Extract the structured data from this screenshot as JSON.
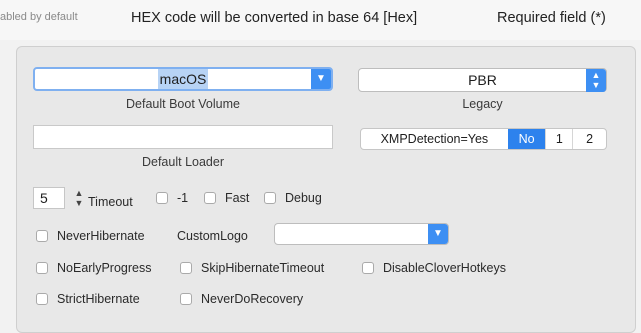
{
  "header": {
    "dim_text": "abled by default",
    "hex_note": "HEX code will be converted in base 64 [Hex]",
    "required_note": "Required field (*)"
  },
  "boot": {
    "default_boot_volume": {
      "value": "macOS",
      "label": "Default Boot Volume"
    },
    "legacy": {
      "value": "PBR",
      "label": "Legacy"
    },
    "default_loader": {
      "value": "",
      "label": "Default Loader"
    },
    "xmp": {
      "label": "XMPDetection=Yes",
      "options": [
        "No",
        "1",
        "2"
      ],
      "selected": "No"
    },
    "timeout": {
      "value": "5",
      "label": "Timeout"
    }
  },
  "checkboxes": {
    "neg1": {
      "label": "-1",
      "checked": false
    },
    "fast": {
      "label": "Fast",
      "checked": false
    },
    "debug": {
      "label": "Debug",
      "checked": false
    },
    "never_hibernate": {
      "label": "NeverHibernate",
      "checked": false
    },
    "no_early_progress": {
      "label": "NoEarlyProgress",
      "checked": false
    },
    "skip_hibernate_timeout": {
      "label": "SkipHibernateTimeout",
      "checked": false
    },
    "disable_clover_hotkeys": {
      "label": "DisableCloverHotkeys",
      "checked": false
    },
    "strict_hibernate": {
      "label": "StrictHibernate",
      "checked": false
    },
    "never_do_recovery": {
      "label": "NeverDoRecovery",
      "checked": false
    }
  },
  "custom_logo": {
    "label": "CustomLogo",
    "value": ""
  },
  "icons": {
    "popup_arrow": "chevron-down-icon",
    "stepper": "stepper-arrows-icon",
    "updown": "up-down-chevron-icon"
  },
  "colors": {
    "accent": "#3d8ff3",
    "segment_selected": "#2d82ed",
    "selection_highlight": "#b7d3f5",
    "focus_ring": "#7fb0f0"
  }
}
